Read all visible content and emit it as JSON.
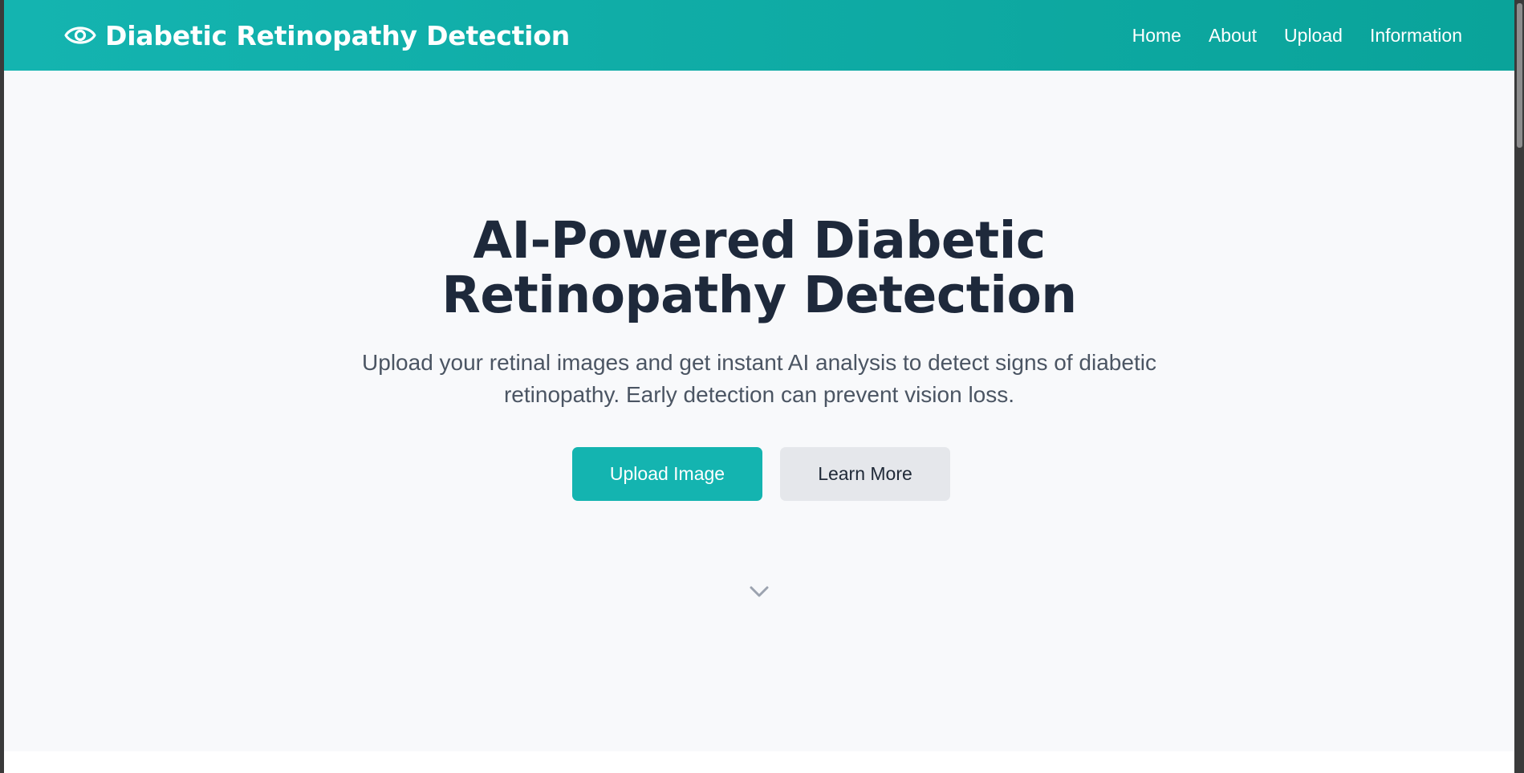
{
  "header": {
    "title": "Diabetic Retinopathy Detection",
    "logo_icon": "eye-icon",
    "background_color": "#14b4b0",
    "nav": [
      {
        "label": "Home"
      },
      {
        "label": "About"
      },
      {
        "label": "Upload"
      },
      {
        "label": "Information"
      }
    ]
  },
  "hero": {
    "title_line1": "AI-Powered Diabetic",
    "title_line2": "Retinopathy Detection",
    "subtitle_line1": "Upload your retinal images and get instant AI analysis to detect signs of diabetic",
    "subtitle_line2": "retinopathy. Early detection can prevent vision loss.",
    "primary_button": "Upload Image",
    "secondary_button": "Learn More",
    "scroll_icon": "chevron-down-icon",
    "accent_color": "#14b4b0",
    "title_color": "#1e293b"
  }
}
